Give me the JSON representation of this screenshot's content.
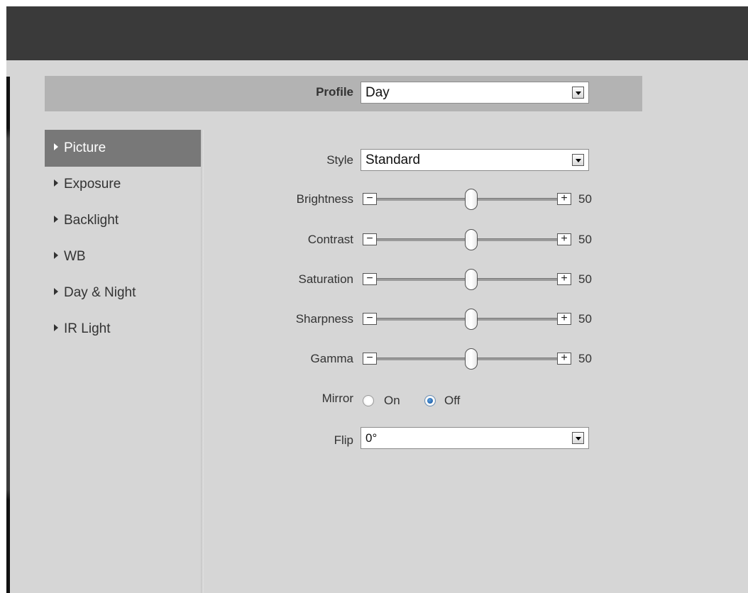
{
  "profile": {
    "label": "Profile",
    "value": "Day"
  },
  "nav": {
    "items": [
      {
        "label": "Picture",
        "active": true
      },
      {
        "label": "Exposure"
      },
      {
        "label": "Backlight"
      },
      {
        "label": "WB"
      },
      {
        "label": "Day & Night"
      },
      {
        "label": "IR Light"
      }
    ]
  },
  "style": {
    "label": "Style",
    "value": "Standard"
  },
  "sliders": [
    {
      "label": "Brightness",
      "value": "50"
    },
    {
      "label": "Contrast",
      "value": "50"
    },
    {
      "label": "Saturation",
      "value": "50"
    },
    {
      "label": "Sharpness",
      "value": "50"
    },
    {
      "label": "Gamma",
      "value": "50"
    }
  ],
  "buttons": {
    "minus": "−",
    "plus": "+"
  },
  "mirror": {
    "label": "Mirror",
    "options": [
      "On",
      "Off"
    ],
    "selected": "Off"
  },
  "flip": {
    "label": "Flip",
    "value": "0°"
  },
  "colors": {
    "topbar": "#3a3a3a",
    "panel": "#d6d6d6",
    "active_nav": "#787878",
    "radio_selected": "#0d4a94"
  }
}
